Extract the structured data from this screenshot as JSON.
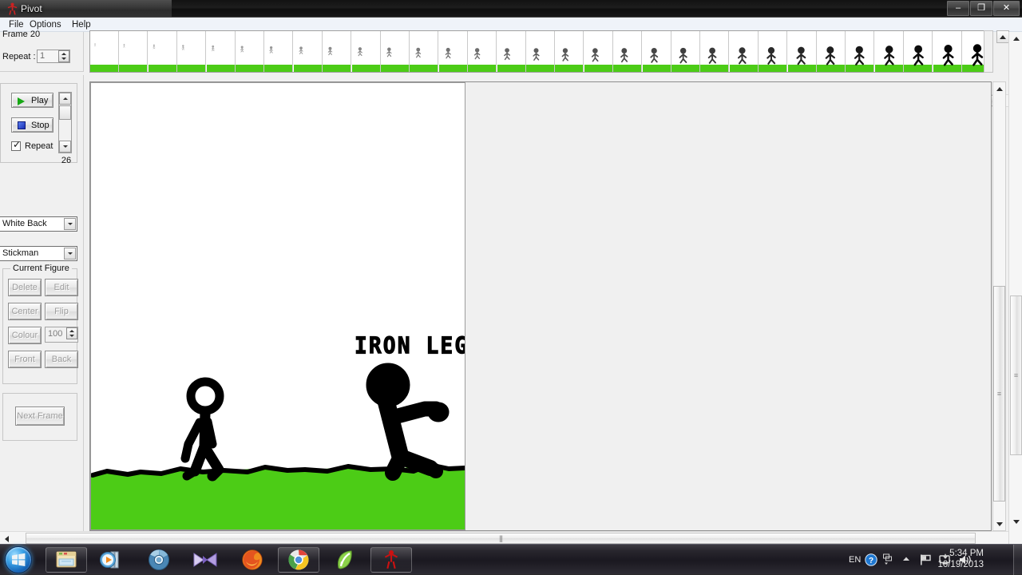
{
  "window": {
    "title": "Pivot",
    "icon": "stickman-icon",
    "minimize_label": "–",
    "maximize_label": "❐",
    "close_label": "✕"
  },
  "menubar": {
    "items": [
      {
        "label": "File",
        "name": "menu-file"
      },
      {
        "label": "Options",
        "name": "menu-options"
      },
      {
        "label": "Help",
        "name": "menu-help"
      }
    ]
  },
  "frame_panel": {
    "frame_label": "Frame 20",
    "repeat_label": "Repeat :",
    "repeat_value": "1"
  },
  "playback": {
    "play_label": "Play",
    "stop_label": "Stop",
    "repeat_label": "Repeat",
    "repeat_checked": true,
    "frame_count": "26"
  },
  "background_select": {
    "value": "White Back",
    "options": [
      "White Back"
    ]
  },
  "figure_select": {
    "value": "Stickman",
    "options": [
      "Stickman"
    ]
  },
  "current_figure": {
    "legend": "Current Figure",
    "delete_label": "Delete",
    "edit_label": "Edit",
    "center_label": "Center",
    "flip_label": "Flip",
    "colour_label": "Colour",
    "colour_value": "100",
    "front_label": "Front",
    "back_label": "Back",
    "all_disabled": true
  },
  "next_frame": {
    "label": "Next Frame",
    "disabled": true
  },
  "canvas": {
    "title_text": "IRON LEGS",
    "background_color": "#ffffff",
    "ground_color": "#4ccc16",
    "figure_color": "#000000",
    "figure_count": 2
  },
  "timeline": {
    "frame_total": 26,
    "visible_frames": 31,
    "thumb_ground_color": "#4ccc16"
  },
  "taskbar": {
    "start_label": "Start",
    "buttons": [
      {
        "name": "taskbar-explorer",
        "icon": "folder-icon"
      },
      {
        "name": "taskbar-media-player",
        "icon": "media-player-icon"
      },
      {
        "name": "taskbar-chromium",
        "icon": "chromium-icon"
      },
      {
        "name": "taskbar-movie-maker",
        "icon": "movie-maker-icon"
      },
      {
        "name": "taskbar-firefox",
        "icon": "firefox-icon"
      },
      {
        "name": "taskbar-chrome",
        "icon": "chrome-icon"
      },
      {
        "name": "taskbar-green-app",
        "icon": "green-leaf-icon"
      },
      {
        "name": "taskbar-pivot",
        "icon": "stickman-icon"
      }
    ],
    "tray": {
      "language": "EN",
      "help_icon": "question-help-icon",
      "network_icon": "network-flag-icon",
      "action_center_icon": "action-center-icon",
      "volume_icon": "volume-icon",
      "time": "5:34 PM",
      "date": "10/19/2013"
    }
  }
}
